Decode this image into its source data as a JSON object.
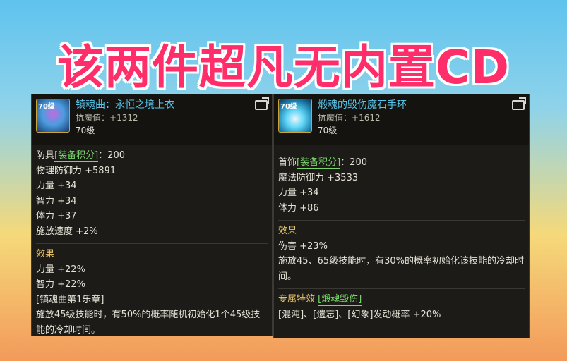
{
  "banner": {
    "title": "该两件超凡无内置CD"
  },
  "left_item": {
    "icon_tag": "70级",
    "name": "镇魂曲：永恒之境上衣",
    "resist_label": "抗魔值：",
    "resist_value": "+1312",
    "level": "70级",
    "slot": "防具",
    "score_label": "[装备积分]",
    "score_value": "：200",
    "stats": [
      "物理防御力 +5891",
      "力量 +34",
      "智力 +34",
      "体力 +37",
      "施放速度 +2%"
    ],
    "effect_title": "效果",
    "effects": [
      "力量 +22%",
      "智力 +22%",
      "[镇魂曲第1乐章]",
      "施放45级技能时，有50%的概率随机初始化1个45级技能的冷却时间。"
    ]
  },
  "right_item": {
    "icon_tag": "70级",
    "name": "煅魂的毁伤魔石手环",
    "resist_label": "抗魔值：",
    "resist_value": "+1612",
    "level": "70级",
    "slot": "首饰",
    "score_label": "[装备积分]",
    "score_value": "：200",
    "stats": [
      "魔法防御力 +3533",
      "力量 +34",
      "体力 +86"
    ],
    "effect_title": "效果",
    "effects": [
      "伤害 +23%",
      "施放45、65级技能时，有30%的概率初始化该技能的冷却时间。"
    ],
    "exclusive_label": "专属特效",
    "exclusive_name": "[煅魂毁伤]",
    "exclusive_text": "[混沌]、[遗忘]、[幻象]发动概率 +20%"
  },
  "colors": {
    "banner": "#ff2e6a",
    "item_name": "#57c4ea",
    "score": "#79d56a",
    "section": "#e8c26a"
  },
  "icons": {
    "export": "export-icon"
  }
}
